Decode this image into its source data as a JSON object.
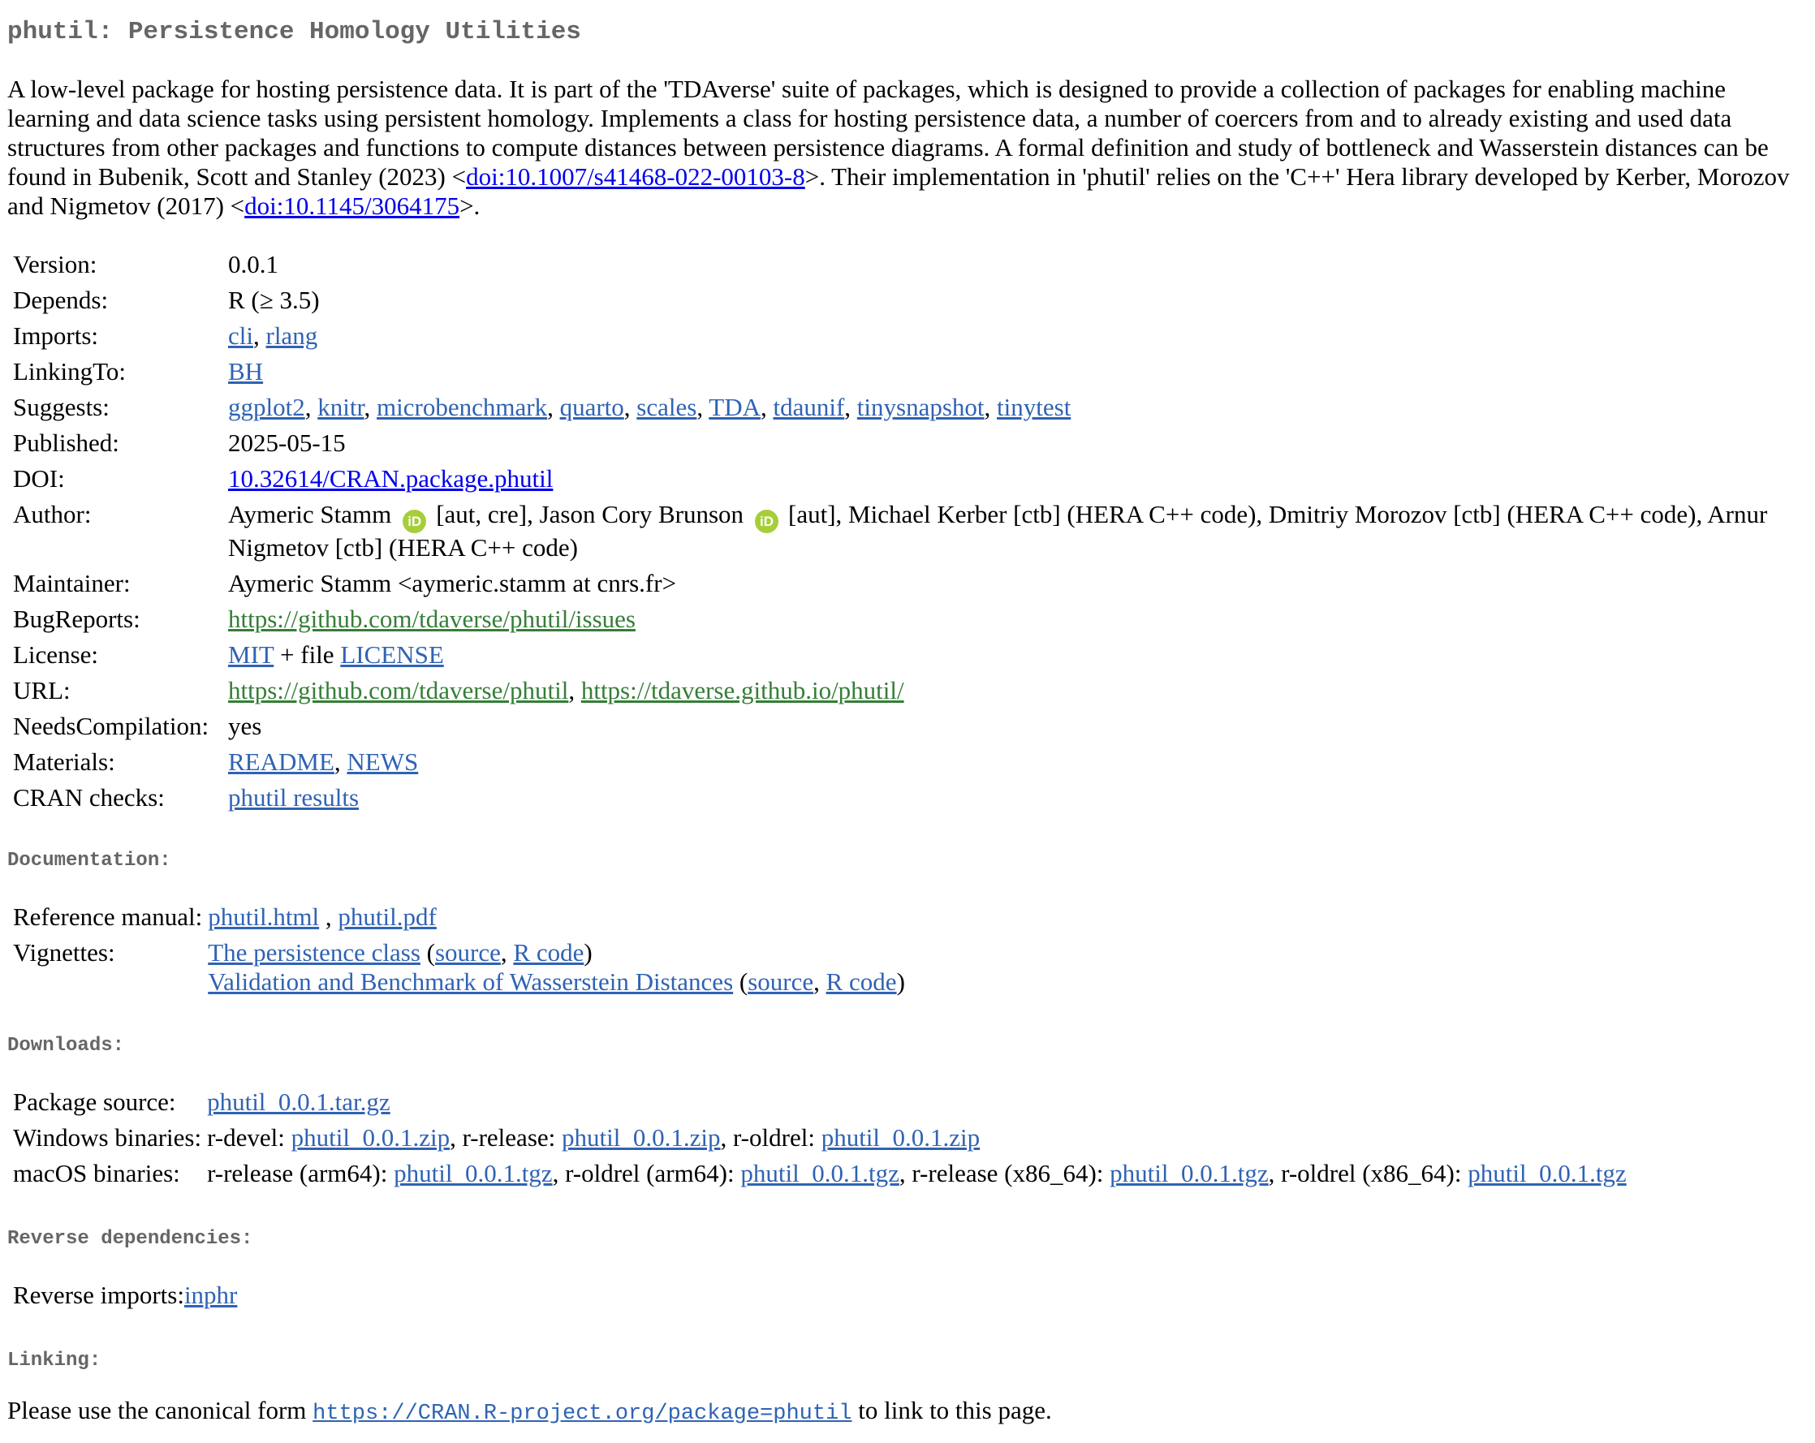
{
  "title": "phutil: Persistence Homology Utilities",
  "description": {
    "part1": "A low-level package for hosting persistence data. It is part of the 'TDAverse' suite of packages, which is designed to provide a collection of packages for enabling machine learning and data science tasks using persistent homology. Implements a class for hosting persistence data, a number of coercers from and to already existing and used data structures from other packages and functions to compute distances between persistence diagrams. A formal definition and study of bottleneck and Wasserstein distances can be found in Bubenik, Scott and Stanley (2023) <",
    "doi1": "doi:10.1007/s41468-022-00103-8",
    "part2": ">. Their implementation in 'phutil' relies on the 'C++' Hera library developed by Kerber, Morozov and Nigmetov (2017) <",
    "doi2": "doi:10.1145/3064175",
    "part3": ">."
  },
  "meta": {
    "version": {
      "label": "Version:",
      "value": "0.0.1"
    },
    "depends": {
      "label": "Depends:",
      "value": "R (≥ 3.5)"
    },
    "imports": {
      "label": "Imports:",
      "items": [
        "cli",
        "rlang"
      ]
    },
    "linkingto": {
      "label": "LinkingTo:",
      "items": [
        "BH"
      ]
    },
    "suggests": {
      "label": "Suggests:",
      "items": [
        "ggplot2",
        "knitr",
        "microbenchmark",
        "quarto",
        "scales",
        "TDA",
        "tdaunif",
        "tinysnapshot",
        "tinytest"
      ]
    },
    "published": {
      "label": "Published:",
      "value": "2025-05-15"
    },
    "doi": {
      "label": "DOI:",
      "value": "10.32614/CRAN.package.phutil"
    },
    "author": {
      "label": "Author:",
      "name1": "Aymeric Stamm",
      "roles1": "[aut, cre], Jason Cory Brunson",
      "roles2": "[aut], Michael Kerber [ctb] (HERA C++ code), Dmitriy Morozov [ctb] (HERA C++ code), Arnur Nigmetov [ctb] (HERA C++ code)",
      "orcid_text": "iD"
    },
    "maintainer": {
      "label": "Maintainer:",
      "value": "Aymeric Stamm <aymeric.stamm at cnrs.fr>"
    },
    "bugreports": {
      "label": "BugReports:",
      "value": "https://github.com/tdaverse/phutil/issues"
    },
    "license": {
      "label": "License:",
      "mit": "MIT",
      "plus": " + file ",
      "file": "LICENSE"
    },
    "url": {
      "label": "URL:",
      "url1": "https://github.com/tdaverse/phutil",
      "url2": "https://tdaverse.github.io/phutil/"
    },
    "needscompilation": {
      "label": "NeedsCompilation:",
      "value": "yes"
    },
    "materials": {
      "label": "Materials:",
      "items": [
        "README",
        "NEWS"
      ]
    },
    "cranchecks": {
      "label": "CRAN checks:",
      "value": "phutil results"
    }
  },
  "documentation": {
    "heading": "Documentation:",
    "refman_label": "Reference manual:",
    "refman_html": "phutil.html",
    "refman_pdf": "phutil.pdf",
    "vignettes_label": "Vignettes:",
    "vignettes": [
      {
        "title": "The persistence class",
        "source": "source",
        "rcode": "R code"
      },
      {
        "title": "Validation and Benchmark of Wasserstein Distances",
        "source": "source",
        "rcode": "R code"
      }
    ]
  },
  "downloads": {
    "heading": "Downloads:",
    "source_label": "Package source:",
    "source_file": "phutil_0.0.1.tar.gz",
    "windows_label": "Windows binaries:",
    "windows": [
      {
        "label": "r-devel: ",
        "file": "phutil_0.0.1.zip"
      },
      {
        "label": "r-release: ",
        "file": "phutil_0.0.1.zip"
      },
      {
        "label": "r-oldrel: ",
        "file": "phutil_0.0.1.zip"
      }
    ],
    "macos_label": "macOS binaries:",
    "macos": [
      {
        "label": "r-release (arm64): ",
        "file": "phutil_0.0.1.tgz"
      },
      {
        "label": "r-oldrel (arm64): ",
        "file": "phutil_0.0.1.tgz"
      },
      {
        "label": "r-release (x86_64): ",
        "file": "phutil_0.0.1.tgz"
      },
      {
        "label": "r-oldrel (x86_64): ",
        "file": "phutil_0.0.1.tgz"
      }
    ]
  },
  "reverse": {
    "heading": "Reverse dependencies:",
    "imports_label": "Reverse imports:",
    "imports_value": "inphr"
  },
  "linking": {
    "heading": "Linking:",
    "before": "Please use the canonical form ",
    "url": "https://CRAN.R-project.org/package=phutil",
    "after": " to link to this page."
  }
}
